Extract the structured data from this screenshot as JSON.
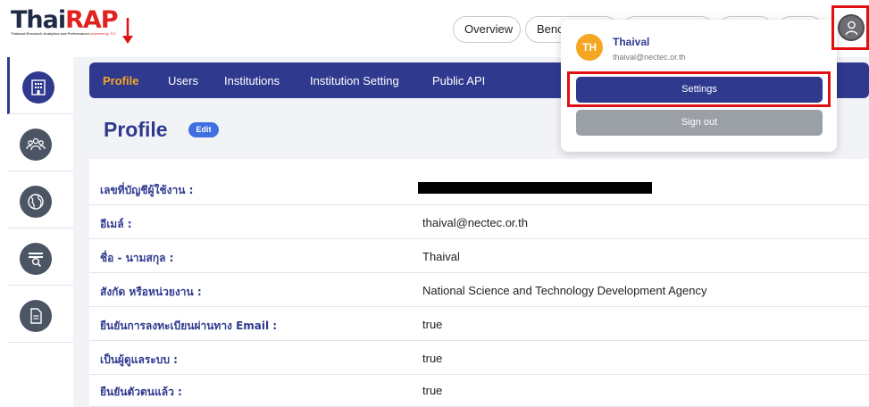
{
  "brand": {
    "name_part1": "Thai",
    "name_part2": "RAP",
    "tagline": "Thailand Research Analytics and Performance",
    "powered_by": "powered by TCI"
  },
  "header": {
    "pills": [
      "Overview",
      "Bench",
      "",
      "",
      ""
    ]
  },
  "sidebar": {
    "items": [
      {
        "name": "institution-icon",
        "active": true
      },
      {
        "name": "people-icon",
        "active": false
      },
      {
        "name": "globe-icon",
        "active": false
      },
      {
        "name": "data-search-icon",
        "active": false
      },
      {
        "name": "document-icon",
        "active": false
      }
    ]
  },
  "nav": {
    "tabs": [
      "Profile",
      "Users",
      "Institutions",
      "Institution Setting",
      "Public API"
    ],
    "active": "Profile"
  },
  "page": {
    "title": "Profile",
    "edit_label": "Edit"
  },
  "profile_rows": [
    {
      "label": "เลขที่บัญชีผู้ใช้งาน :",
      "value": ""
    },
    {
      "label": "อีเมล์ :",
      "value": "thaival@nectec.or.th"
    },
    {
      "label": "ชื่อ - นามสกุล :",
      "value": "Thaival"
    },
    {
      "label": "สังกัด หรือหน่วยงาน :",
      "value": "National Science and Technology Development Agency"
    },
    {
      "label": "ยืนยันการลงทะเบียนผ่านทาง Email :",
      "value": "true"
    },
    {
      "label": "เป็นผู้ดูแลระบบ :",
      "value": "true"
    },
    {
      "label": "ยืนยันตัวตนแล้ว :",
      "value": "true"
    }
  ],
  "user_menu": {
    "initials": "TH",
    "name": "Thaival",
    "email": "thaival@nectec.or.th",
    "settings_label": "Settings",
    "signout_label": "Sign out"
  },
  "colors": {
    "primary": "#2f3a8f",
    "accent": "#f5a623",
    "highlight": "#e01010",
    "brand_red": "#e0231f"
  }
}
